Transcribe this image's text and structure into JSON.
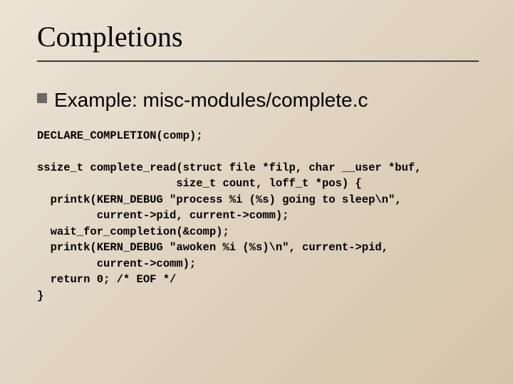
{
  "title": "Completions",
  "bullet": "Example: misc-modules/complete.c",
  "code": "DECLARE_COMPLETION(comp);\n\nssize_t complete_read(struct file *filp, char __user *buf,\n                     size_t count, loff_t *pos) {\n  printk(KERN_DEBUG \"process %i (%s) going to sleep\\n\",\n         current->pid, current->comm);\n  wait_for_completion(&comp);\n  printk(KERN_DEBUG \"awoken %i (%s)\\n\", current->pid,\n         current->comm);\n  return 0; /* EOF */\n}"
}
